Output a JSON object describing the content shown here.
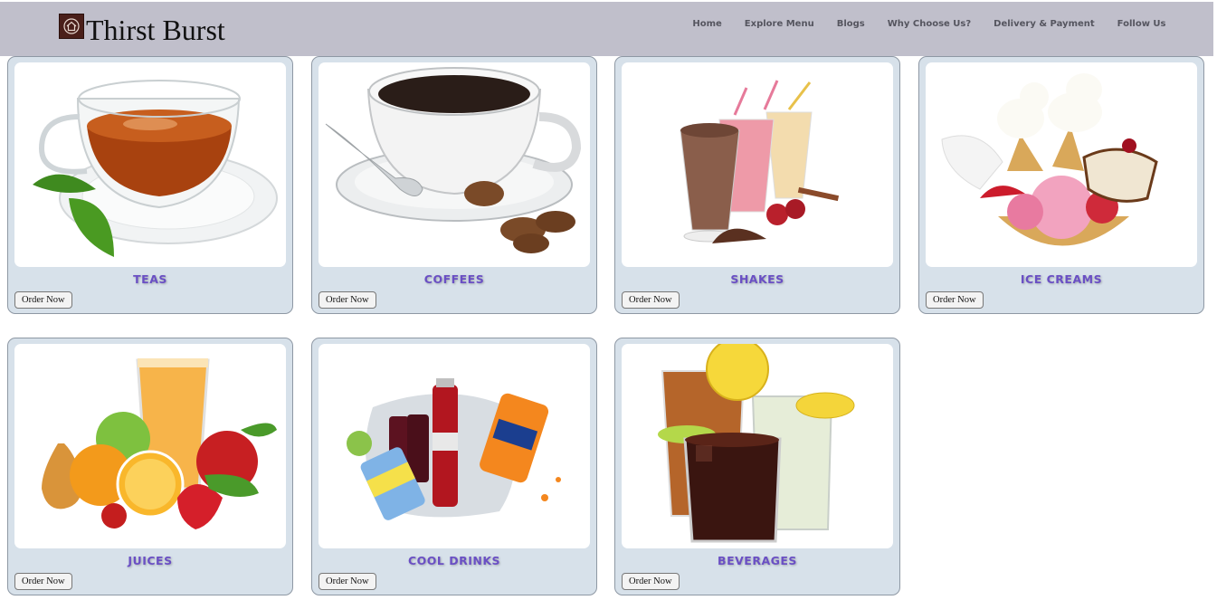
{
  "brand": {
    "name": "Thirst Burst",
    "logo_icon": "house-logo-icon"
  },
  "nav": {
    "items": [
      "Home",
      "Explore Menu",
      "Blogs",
      "Why Choose Us?",
      "Delivery & Payment",
      "Follow Us"
    ]
  },
  "colors": {
    "navbar_bg": "#c0bfcb",
    "card_bg": "#d7e1ea",
    "title_color": "#6a4fc4"
  },
  "categories": [
    {
      "title": "TEAS",
      "button": "Order Now",
      "image": "tea-cup-image"
    },
    {
      "title": "COFFEES",
      "button": "Order Now",
      "image": "coffee-cup-image"
    },
    {
      "title": "SHAKES",
      "button": "Order Now",
      "image": "milkshakes-image"
    },
    {
      "title": "ICE CREAMS",
      "button": "Order Now",
      "image": "ice-creams-image"
    },
    {
      "title": "JUICES",
      "button": "Order Now",
      "image": "juice-fruits-image"
    },
    {
      "title": "COOL DRINKS",
      "button": "Order Now",
      "image": "cool-drinks-image"
    },
    {
      "title": "BEVERAGES",
      "button": "Order Now",
      "image": "beverages-image"
    }
  ]
}
